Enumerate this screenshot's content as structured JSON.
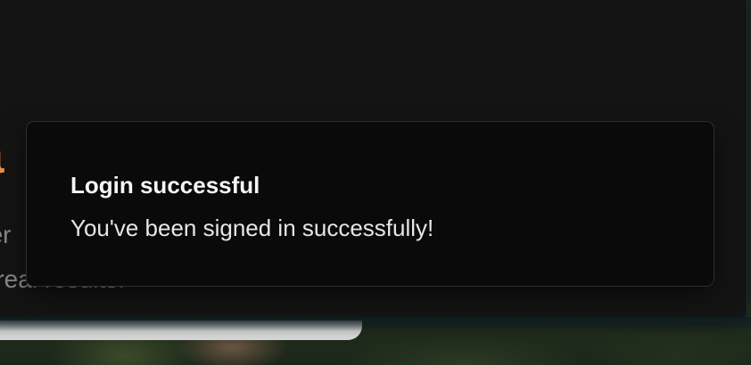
{
  "background": {
    "hero_heading_fragment": "a",
    "hero_line_1_fragment": "eer",
    "hero_line_2_fragment": "e real results."
  },
  "toast": {
    "title": "Login successful",
    "description": "You've been signed in successfully!"
  },
  "colors": {
    "accent": "#e8904a",
    "toast_background": "#0a0a0b",
    "panel_background": "#141414"
  }
}
